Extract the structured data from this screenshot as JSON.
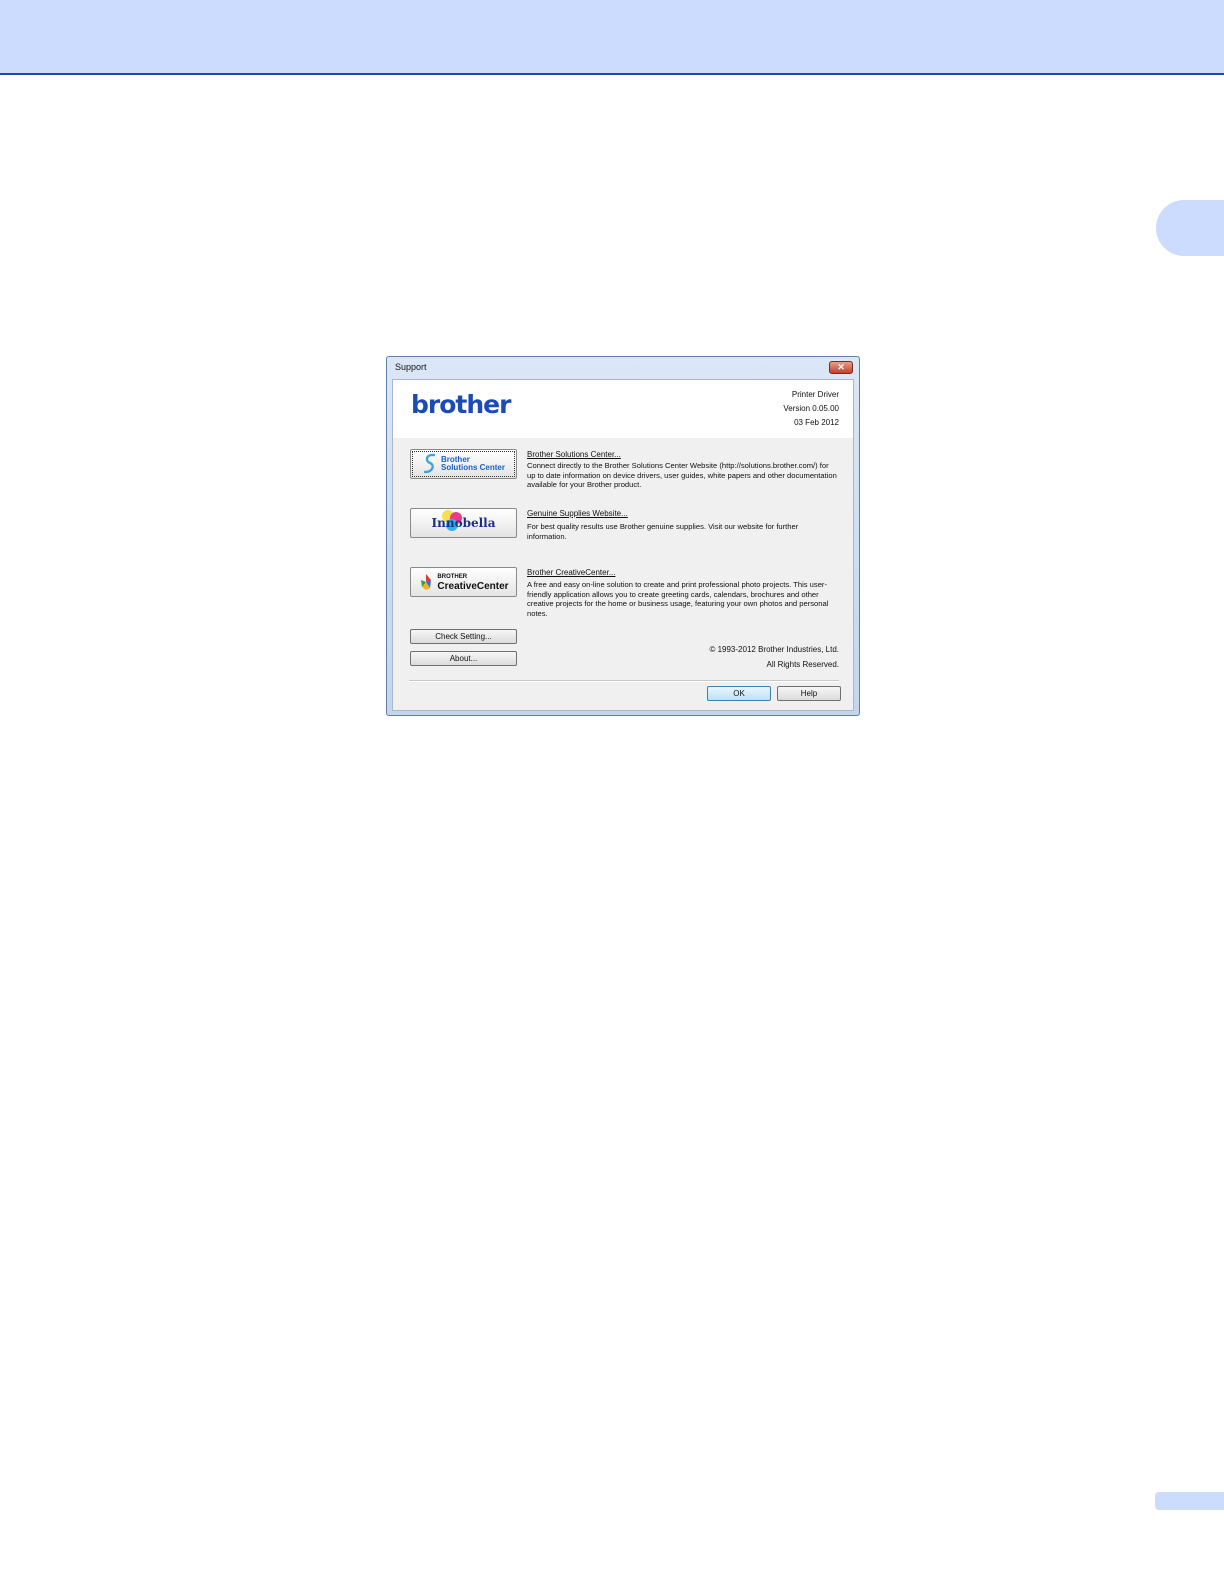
{
  "dialog": {
    "title": "Support",
    "close_glyph": "✕",
    "brand": "brother",
    "info": {
      "product": "Printer Driver",
      "version": "Version 0.05.00",
      "date": "03 Feb 2012"
    },
    "entries": [
      {
        "logo_line1": "Brother",
        "logo_line2": "Solutions Center",
        "title": "Brother Solutions Center...",
        "description": "Connect directly to the Brother Solutions Center Website (http://solutions.brother.com/) for up to date information on device drivers, user guides, white papers and other documentation available for your Brother product."
      },
      {
        "logo_text": "Innobella",
        "title": "Genuine Supplies Website...",
        "description": "For best quality results use Brother genuine supplies. Visit our website for further information."
      },
      {
        "logo_line1": "BROTHER",
        "logo_line2": "CreativeCenter",
        "title": "Brother CreativeCenter...",
        "description": "A free and easy on-line solution to create and print professional photo projects. This user-friendly application allows you to create greeting cards, calendars, brochures and other creative projects for the home or business usage, featuring your own photos and personal notes."
      }
    ],
    "check_setting_label": "Check Setting...",
    "about_label": "About...",
    "copyright_line1": "© 1993-2012 Brother Industries, Ltd.",
    "copyright_line2": "All Rights Reserved.",
    "ok_label": "OK",
    "help_label": "Help"
  },
  "colors": {
    "page_band": "#ccdcff",
    "brand_blue": "#1b4bb5"
  }
}
